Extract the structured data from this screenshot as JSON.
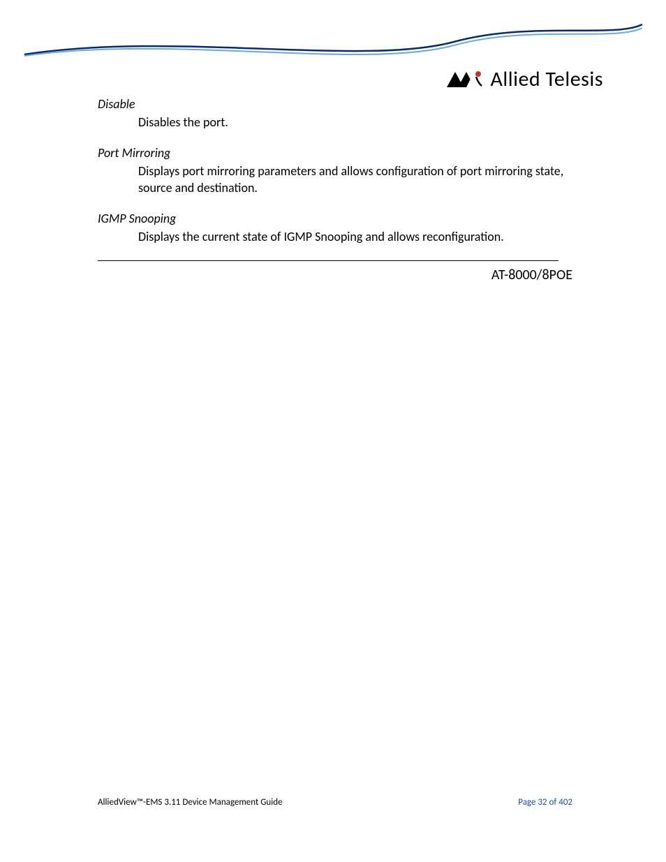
{
  "brand": {
    "name": "Allied Telesis"
  },
  "sections": [
    {
      "term": "Disable",
      "desc": "Disables the port."
    },
    {
      "term": "Port Mirroring",
      "desc": "Displays port mirroring parameters and allows configuration of port mirroring state, source and destination."
    },
    {
      "term": "IGMP Snooping",
      "desc": "Displays the current state of IGMP Snooping and allows reconfiguration."
    }
  ],
  "model_heading": "AT-8000/8POE",
  "footer": {
    "doc_title": "AlliedView™-EMS 3.11 Device Management Guide",
    "page_label": "Page 32 of 402"
  }
}
